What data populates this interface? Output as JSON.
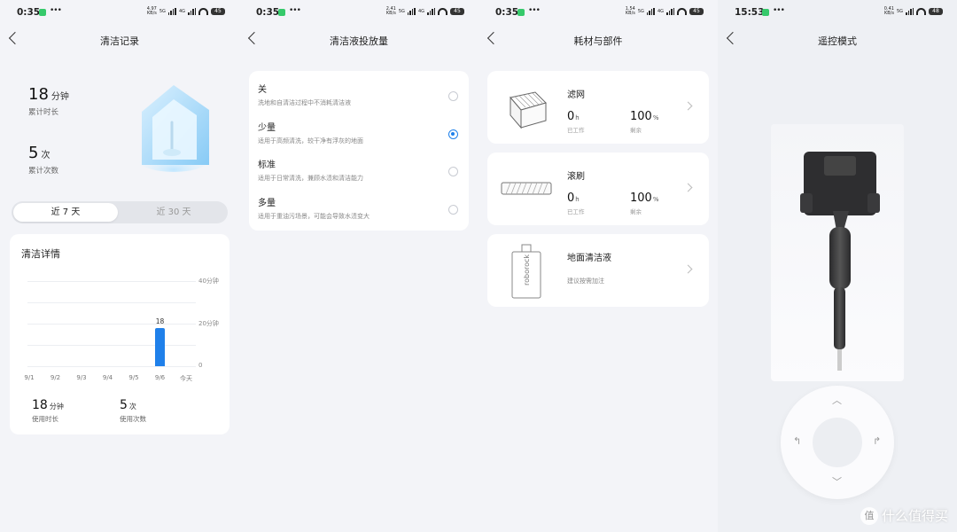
{
  "colors": {
    "accent": "#1f80ea",
    "background": "#f3f4f8",
    "status_app": "#36c96b"
  },
  "status_bars": [
    {
      "time": "0:35",
      "net_speed": "4.97",
      "net_unit": "KB/s",
      "net_type": "5G",
      "net_type2": "4G",
      "battery": "45"
    },
    {
      "time": "0:35",
      "net_speed": "2.41",
      "net_unit": "KB/s",
      "net_type": "5G",
      "net_type2": "4G",
      "battery": "45"
    },
    {
      "time": "0:35",
      "net_speed": "1.54",
      "net_unit": "KB/s",
      "net_type": "5G",
      "net_type2": "4G",
      "battery": "45"
    },
    {
      "time": "15:53",
      "net_speed": "0.41",
      "net_unit": "KB/s",
      "net_type": "5G",
      "net_type2": "",
      "battery": "48"
    }
  ],
  "screen1": {
    "title": "清洁记录",
    "duration": {
      "value": "18",
      "unit": "分钟",
      "label": "累计时长"
    },
    "count": {
      "value": "5",
      "unit": "次",
      "label": "累计次数"
    },
    "tabs": [
      {
        "label": "近 7 天"
      },
      {
        "label": "近 30 天"
      }
    ],
    "card_title": "清洁详情",
    "y_ticks": [
      "40分钟",
      "20分钟",
      "0"
    ],
    "usage_time": {
      "value": "18",
      "unit": "分钟",
      "label": "使用时长"
    },
    "usage_count": {
      "value": "5",
      "unit": "次",
      "label": "使用次数"
    }
  },
  "chart_data": {
    "type": "bar",
    "categories": [
      "9/1",
      "9/2",
      "9/3",
      "9/4",
      "9/5",
      "9/6",
      "今天"
    ],
    "values": [
      0,
      0,
      0,
      0,
      0,
      18,
      0
    ],
    "data_labels": [
      "",
      "",
      "",
      "",
      "",
      "18",
      ""
    ],
    "ylim": [
      0,
      40
    ],
    "y_tick_labels": [
      "0",
      "20分钟",
      "40分钟"
    ],
    "grid": true,
    "title": "清洁详情"
  },
  "screen2": {
    "title": "清洁液投放量",
    "options": [
      {
        "label": "关",
        "desc": "洗地和自清洁过程中不消耗清洁液",
        "selected": false
      },
      {
        "label": "少量",
        "desc": "适用于高频清洗，较干净有浮灰的地面",
        "selected": true
      },
      {
        "label": "标准",
        "desc": "适用于日常清洗，兼顾水渍和清洁能力",
        "selected": false
      },
      {
        "label": "多量",
        "desc": "适用于重油污场景，可能会导致水渍变大",
        "selected": false
      }
    ]
  },
  "screen3": {
    "title": "耗材与部件",
    "parts": [
      {
        "name": "滤网",
        "icon": "filter-icon",
        "worked": "0",
        "worked_unit": "h",
        "worked_label": "已工作",
        "remain": "100",
        "remain_unit": "%",
        "remain_label": "剩余"
      },
      {
        "name": "滚刷",
        "icon": "roller-brush-icon",
        "worked": "0",
        "worked_unit": "h",
        "worked_label": "已工作",
        "remain": "100",
        "remain_unit": "%",
        "remain_label": "剩余"
      }
    ],
    "solution": {
      "name": "地面清洁液",
      "icon": "bottle-icon",
      "desc": "建议按需加注",
      "bottle_text": "roborock"
    }
  },
  "screen4": {
    "title": "遥控模式",
    "watermark": "什么值得买",
    "watermark_logo": "值"
  }
}
